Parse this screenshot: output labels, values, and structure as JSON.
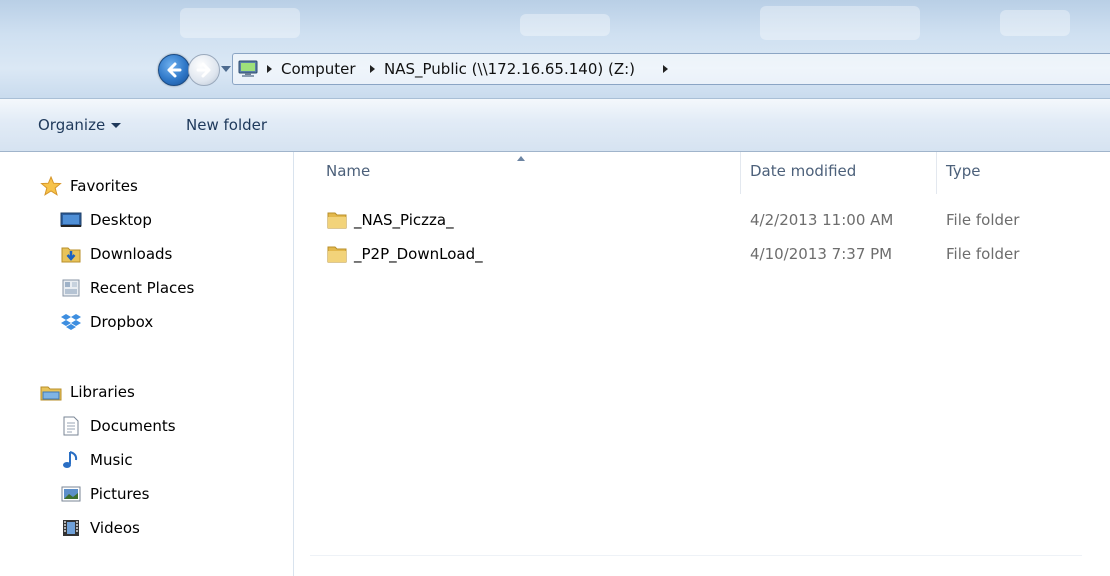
{
  "address": {
    "breadcrumbs": [
      "Computer",
      "NAS_Public (\\\\172.16.65.140) (Z:)"
    ]
  },
  "toolbar": {
    "organize_label": "Organize",
    "new_folder_label": "New folder"
  },
  "sidebar": {
    "favorites": {
      "label": "Favorites",
      "items": [
        {
          "label": "Desktop",
          "icon": "desktop-icon"
        },
        {
          "label": "Downloads",
          "icon": "downloads-folder-icon"
        },
        {
          "label": "Recent Places",
          "icon": "recent-places-icon"
        },
        {
          "label": "Dropbox",
          "icon": "dropbox-icon"
        }
      ]
    },
    "libraries": {
      "label": "Libraries",
      "items": [
        {
          "label": "Documents",
          "icon": "documents-icon"
        },
        {
          "label": "Music",
          "icon": "music-icon"
        },
        {
          "label": "Pictures",
          "icon": "pictures-icon"
        },
        {
          "label": "Videos",
          "icon": "videos-icon"
        }
      ]
    }
  },
  "filelist": {
    "columns": {
      "name": "Name",
      "date": "Date modified",
      "type": "Type"
    },
    "rows": [
      {
        "name": "_NAS_Piczza_",
        "date": "4/2/2013 11:00 AM",
        "type": "File folder"
      },
      {
        "name": "_P2P_DownLoad_",
        "date": "4/10/2013 7:37 PM",
        "type": "File folder"
      }
    ]
  },
  "colors": {
    "accent": "#2f78c8",
    "folder": "#e8c35a"
  }
}
